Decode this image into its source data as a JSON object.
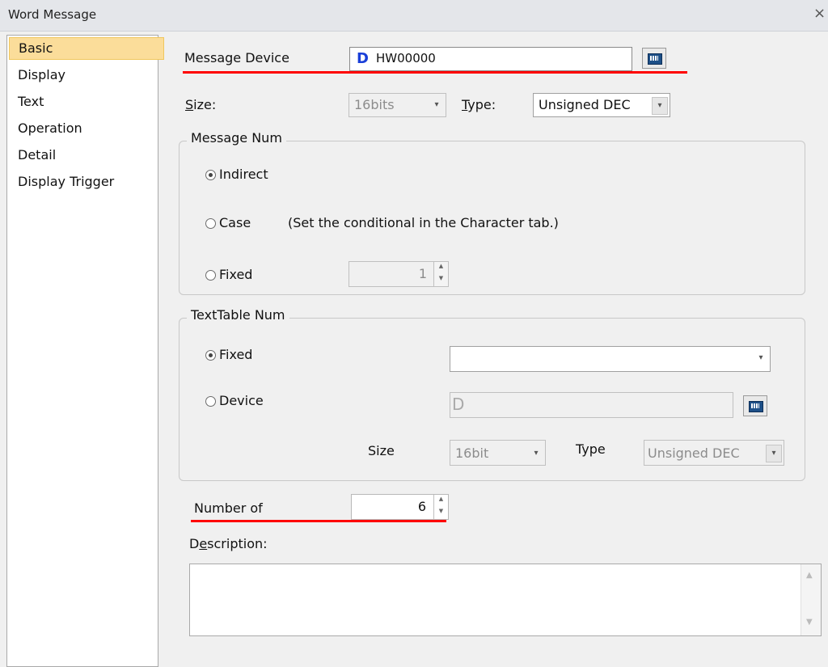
{
  "window": {
    "title": "Word Message",
    "close": "×"
  },
  "sidebar": {
    "items": [
      {
        "label": "Basic",
        "selected": true
      },
      {
        "label": "Display"
      },
      {
        "label": "Text"
      },
      {
        "label": "Operation"
      },
      {
        "label": "Detail"
      },
      {
        "label": "Display Trigger"
      }
    ]
  },
  "basic": {
    "message_device": {
      "label": "Message Device",
      "prefix": "D",
      "value": "HW00000"
    },
    "size": {
      "label": "Size:",
      "value": "16bits",
      "arrow": "▾"
    },
    "type": {
      "label": "Type:",
      "value": "Unsigned DEC",
      "arrow": "▾"
    },
    "message_num": {
      "legend": "Message Num",
      "indirect": "Indirect",
      "case": "Case",
      "case_note": "(Set the conditional in the Character tab.)",
      "fixed": "Fixed",
      "fixed_value": "1",
      "selected": "indirect"
    },
    "texttable_num": {
      "legend": "TextTable Num",
      "fixed": "Fixed",
      "fixed_value": "",
      "device": "Device",
      "device_value": "D",
      "size_label": "Size",
      "size_value": "16bit",
      "type_label": "Type",
      "type_value": "Unsigned DEC",
      "selected": "fixed"
    },
    "number_of": {
      "label": "Number of",
      "value": "6"
    },
    "description": {
      "label": "Description:",
      "value": ""
    }
  },
  "spin_arrows": {
    "up": "▲",
    "down": "▼"
  },
  "colors": {
    "accent_underline": "#ff0000",
    "selected_item_bg": "#fbdd9a"
  }
}
